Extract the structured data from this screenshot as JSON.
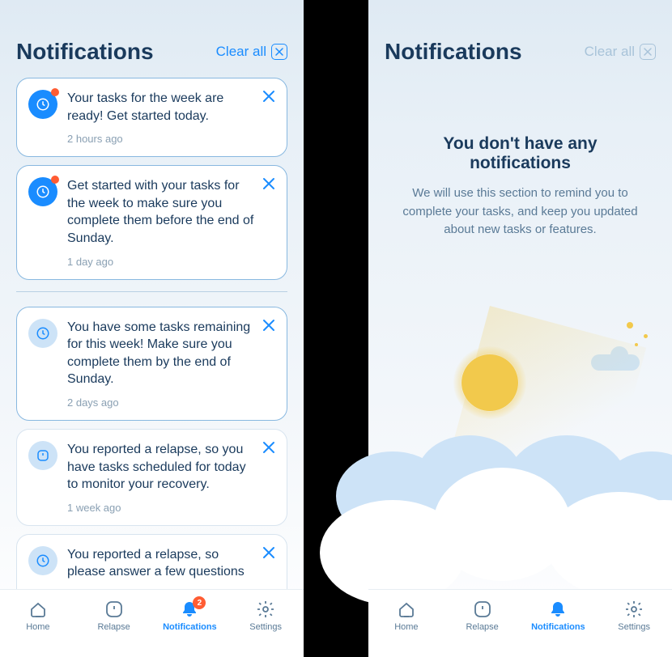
{
  "left": {
    "header": {
      "title": "Notifications",
      "clear_all": "Clear all"
    },
    "notifications": [
      {
        "icon": "clock",
        "unread": true,
        "text": "Your tasks for the week are ready! Get started today.",
        "time": "2 hours ago"
      },
      {
        "icon": "clock",
        "unread": true,
        "text": "Get started with your tasks for the week to make sure you complete them before the end of Sunday.",
        "time": "1 day ago"
      },
      {
        "icon": "clock",
        "unread": false,
        "text": "You have some tasks remaining for this week! Make sure you complete them by the end of Sunday.",
        "time": "2 days ago"
      },
      {
        "icon": "alert",
        "unread": false,
        "text": "You reported a relapse, so you have tasks scheduled for today to monitor your recovery.",
        "time": "1 week ago"
      },
      {
        "icon": "clock",
        "unread": false,
        "text": "You reported a relapse, so please answer a few questions",
        "time": ""
      }
    ],
    "navbar": {
      "home": "Home",
      "relapse": "Relapse",
      "notifications": "Notifications",
      "settings": "Settings",
      "badge": "2"
    }
  },
  "right": {
    "header": {
      "title": "Notifications",
      "clear_all": "Clear all"
    },
    "empty": {
      "title": "You don't have any notifications",
      "desc": "We will use this section to remind you to complete your tasks, and keep you updated about new tasks or features."
    },
    "navbar": {
      "home": "Home",
      "relapse": "Relapse",
      "notifications": "Notifications",
      "settings": "Settings"
    }
  }
}
